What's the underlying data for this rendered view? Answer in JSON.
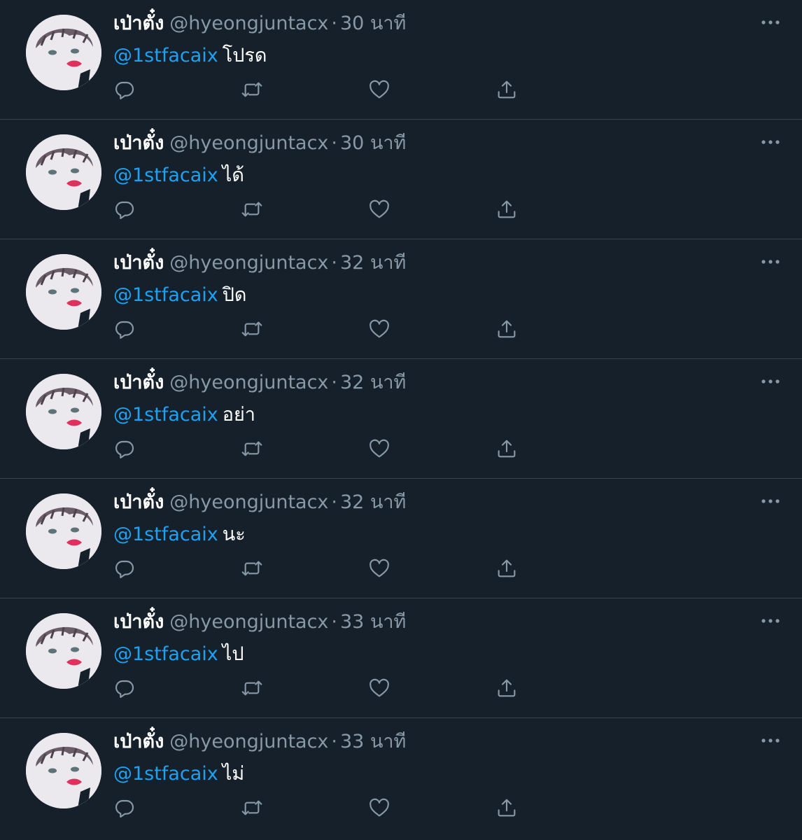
{
  "tweets": [
    {
      "name": "เป่าตั๋ง",
      "handle": "@hyeongjuntacx",
      "time": "30 นาที",
      "mention": "@1stfacaix",
      "text": "โปรด"
    },
    {
      "name": "เป่าตั๋ง",
      "handle": "@hyeongjuntacx",
      "time": "30 นาที",
      "mention": "@1stfacaix",
      "text": "ได้"
    },
    {
      "name": "เป่าตั๋ง",
      "handle": "@hyeongjuntacx",
      "time": "32 นาที",
      "mention": "@1stfacaix",
      "text": "ปิด"
    },
    {
      "name": "เป่าตั๋ง",
      "handle": "@hyeongjuntacx",
      "time": "32 นาที",
      "mention": "@1stfacaix",
      "text": "อย่า"
    },
    {
      "name": "เป่าตั๋ง",
      "handle": "@hyeongjuntacx",
      "time": "32 นาที",
      "mention": "@1stfacaix",
      "text": "นะ"
    },
    {
      "name": "เป่าตั๋ง",
      "handle": "@hyeongjuntacx",
      "time": "33 นาที",
      "mention": "@1stfacaix",
      "text": "ไป"
    },
    {
      "name": "เป่าตั๋ง",
      "handle": "@hyeongjuntacx",
      "time": "33 นาที",
      "mention": "@1stfacaix",
      "text": "ไม่"
    }
  ],
  "separator": "·",
  "icons": {
    "reply": "reply-icon",
    "retweet": "retweet-icon",
    "like": "heart-icon",
    "share": "share-icon",
    "more": "more-icon"
  },
  "colors": {
    "background": "#15202b",
    "mention": "#1da1f2",
    "secondary_text": "#8899a6",
    "divider": "#38444d"
  }
}
